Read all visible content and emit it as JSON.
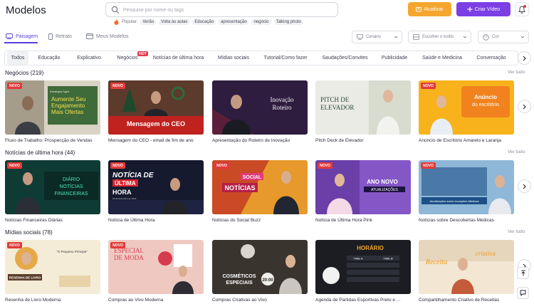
{
  "header": {
    "title": "Modelos",
    "search_placeholder": "Pesquise por nome ou tags",
    "popular_label": "Popular:",
    "popular_tags": [
      "Verão",
      "Volta às aulas",
      "Educação",
      "apresentação",
      "negócio",
      "Talking photo"
    ],
    "upgrade_label": "Atualizar",
    "create_label": "Criar Vídeo"
  },
  "orientation_tabs": [
    "Paisagem",
    "Retrato",
    "Meus Modelos"
  ],
  "filters": {
    "scenario": "Cenário",
    "style": "Escolher o estilo",
    "color": "Cor"
  },
  "categories": [
    "Todos",
    "Educação",
    "Explicativo",
    "Negócios",
    "Notícias de última hora",
    "Mídias sociais",
    "Tutorial/Como fazer",
    "Saudações/Convites",
    "Publicidade",
    "Saúde e Medicina",
    "Conversação"
  ],
  "hot_label": "HOT",
  "see_all": "Ver tudo",
  "new_badge": "NOVO",
  "sections": [
    {
      "title": "Negócios (219)",
      "cards": [
        {
          "label": "Fluxo de Trabalho: Prospecção de Vendas",
          "thumb_text": [
            "Aumente Seu",
            "Engajamento",
            "Mais Ofertas"
          ],
          "thumb_small": "Estratégias Ágeis"
        },
        {
          "label": "Mensagem do CEO - email de fim de ano",
          "thumb_text": [
            "Mensagem do CEO"
          ]
        },
        {
          "label": "Apresentação do Roteiro de Inovação",
          "thumb_text": [
            "Inovação",
            "Roteiro"
          ]
        },
        {
          "label": "Pitch Deck de Elevador",
          "thumb_text": [
            "PITCH DE",
            "ELEVADOR"
          ]
        },
        {
          "label": "Anúncio de Escritório Amarelo e Laranja",
          "thumb_text": [
            "Anúncio",
            "do escritório"
          ]
        }
      ]
    },
    {
      "title": "Notícias de última hora (44)",
      "cards": [
        {
          "label": "Notícias Financeiras Diárias",
          "thumb_text": [
            "DIÁRIO",
            "NOTÍCIAS",
            "FINANCEIRAS"
          ]
        },
        {
          "label": "Notícia de Última Hora",
          "thumb_text": [
            "NOTÍCIA DE",
            "ÚLTIMA",
            "HORA"
          ],
          "thumb_small": "18 de dezembro de 2024"
        },
        {
          "label": "Notícias do Social Buzz",
          "thumb_text": [
            "SOCIAL",
            "NOTÍCIAS"
          ]
        },
        {
          "label": "Notícia de Última Hora Pink",
          "thumb_text": [
            "ANO NOVO",
            "ATUALIZAÇÕES"
          ]
        },
        {
          "label": "Notícias sobre Descobertas Médicas",
          "thumb_text": [
            "Atualizações sobre inovações Médicas"
          ]
        }
      ]
    },
    {
      "title": "Mídias sociais (78)",
      "cards": [
        {
          "label": "Resenha de Livro Moderna",
          "thumb_text": [
            "\"O Pequeno Príncipe\"",
            "RESENHA DE LIVRO"
          ]
        },
        {
          "label": "Compras ao Vivo Moderna",
          "thumb_text": [
            "ESPECIAL",
            "DE MODA"
          ]
        },
        {
          "label": "Compras Criativas ao Vivo",
          "thumb_text": [
            "COSMÉTICOS",
            "ESPECIAIS",
            "20:00"
          ]
        },
        {
          "label": "Agenda de Partidas Esportivas Preto e ...",
          "thumb_text": [
            "HORÁRIO",
            "TIME A",
            "TIME B"
          ]
        },
        {
          "label": "Compartilhamento Criativo de Receitas",
          "thumb_text": [
            "Receita",
            "criativa"
          ]
        }
      ]
    }
  ],
  "colors": {
    "accent": "#7b3fe4",
    "upgrade": "#f5a62e",
    "new_badge": "#e23a3a"
  }
}
